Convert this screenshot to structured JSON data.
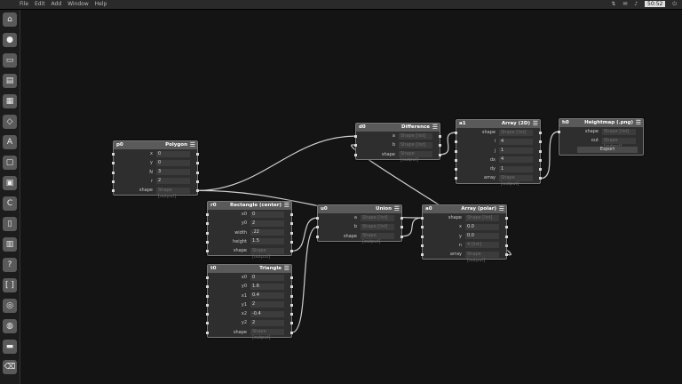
{
  "menubar": {
    "items": [
      "File",
      "Edit",
      "Add",
      "Window",
      "Help"
    ],
    "clock": "50:52"
  },
  "launcher": {
    "icons": [
      "home-icon",
      "circle-icon",
      "terminal-icon",
      "files-icon",
      "browser-icon",
      "shape-icon",
      "text-icon",
      "window-icon",
      "monitor-icon",
      "c-icon",
      "doc-icon",
      "box-icon",
      "help-icon",
      "bracket-icon",
      "disc-icon",
      "globe-icon",
      "drive-icon",
      "trash-icon"
    ]
  },
  "nodes": [
    {
      "key": "p0",
      "id": "p0",
      "title": "Polygon",
      "rows": [
        {
          "label": "x",
          "value": "0",
          "in": true,
          "out": true
        },
        {
          "label": "y",
          "value": "0",
          "in": true,
          "out": true
        },
        {
          "label": "N",
          "value": "3",
          "in": true,
          "out": true
        },
        {
          "label": "r",
          "value": "2",
          "in": true,
          "out": true
        },
        {
          "label": "shape",
          "value": "Shape [output]",
          "in": true,
          "out": true,
          "ph": true
        }
      ]
    },
    {
      "key": "d0",
      "id": "d0",
      "title": "Difference",
      "rows": [
        {
          "label": "a",
          "value": "Shape [list]",
          "in": true,
          "out": true,
          "ph": true
        },
        {
          "label": "b",
          "value": "Shape [list]",
          "in": true,
          "out": true,
          "ph": true
        },
        {
          "label": "shape",
          "value": "Shape [output]",
          "in": true,
          "out": true,
          "ph": true
        }
      ]
    },
    {
      "key": "a1",
      "id": "a1",
      "title": "Array (2D)",
      "rows": [
        {
          "label": "shape",
          "value": "Shape [list]",
          "in": true,
          "out": true,
          "ph": true
        },
        {
          "label": "i",
          "value": "4",
          "in": true,
          "out": true
        },
        {
          "label": "j",
          "value": "1",
          "in": true,
          "out": true
        },
        {
          "label": "dx",
          "value": "4",
          "in": true,
          "out": true
        },
        {
          "label": "dy",
          "value": "1",
          "in": true,
          "out": true
        },
        {
          "label": "array",
          "value": "Shape [output]",
          "in": true,
          "out": true,
          "ph": true
        }
      ]
    },
    {
      "key": "h0",
      "id": "h0",
      "title": "Heightmap (.png)",
      "rows": [
        {
          "label": "shape",
          "value": "Shape [list]",
          "in": true,
          "out": false,
          "ph": true
        },
        {
          "label": "out",
          "value": "Shape [output]",
          "in": false,
          "out": false,
          "ph": true
        }
      ],
      "button": "Export"
    },
    {
      "key": "r0",
      "id": "r0",
      "title": "Rectangle (center)",
      "rows": [
        {
          "label": "x0",
          "value": "0",
          "in": true,
          "out": true
        },
        {
          "label": "y0",
          "value": "2",
          "in": true,
          "out": true
        },
        {
          "label": "width",
          "value": ".22",
          "in": true,
          "out": true
        },
        {
          "label": "height",
          "value": "1.5",
          "in": true,
          "out": true
        },
        {
          "label": "shape",
          "value": "Shape [output]",
          "in": true,
          "out": true,
          "ph": true
        }
      ]
    },
    {
      "key": "u0",
      "id": "u0",
      "title": "Union",
      "rows": [
        {
          "label": "a",
          "value": "Shape [list]",
          "in": true,
          "out": true,
          "ph": true
        },
        {
          "label": "b",
          "value": "Shape [list]",
          "in": true,
          "out": true,
          "ph": true
        },
        {
          "label": "shape",
          "value": "Shape [output]",
          "in": true,
          "out": true,
          "ph": true
        }
      ]
    },
    {
      "key": "a0",
      "id": "a0",
      "title": "Array (polar)",
      "rows": [
        {
          "label": "shape",
          "value": "Shape [list]",
          "in": true,
          "out": true,
          "ph": true
        },
        {
          "label": "x",
          "value": "0.0",
          "in": true,
          "out": true
        },
        {
          "label": "y",
          "value": "0.0",
          "in": true,
          "out": true
        },
        {
          "label": "n",
          "value": "4 [list]",
          "in": true,
          "out": true,
          "ph": true
        },
        {
          "label": "array",
          "value": "Shape [output]",
          "in": true,
          "out": true,
          "ph": true
        }
      ]
    },
    {
      "key": "t0",
      "id": "t0",
      "title": "Triangle",
      "rows": [
        {
          "label": "x0",
          "value": "0",
          "in": true,
          "out": true
        },
        {
          "label": "y0",
          "value": "1.6",
          "in": true,
          "out": true
        },
        {
          "label": "x1",
          "value": "0.4",
          "in": true,
          "out": true
        },
        {
          "label": "y1",
          "value": "2",
          "in": true,
          "out": true
        },
        {
          "label": "x2",
          "value": "-0.4",
          "in": true,
          "out": true
        },
        {
          "label": "y2",
          "value": "2",
          "in": true,
          "out": true
        },
        {
          "label": "shape",
          "value": "Shape [output]",
          "in": true,
          "out": true,
          "ph": true
        }
      ]
    }
  ],
  "connections": [
    {
      "from": "p0.4",
      "to": "d0.0"
    },
    {
      "from": "p0.4",
      "to": "a0.0"
    },
    {
      "from": "d0.2",
      "to": "a1.0"
    },
    {
      "from": "a1.5",
      "to": "h0.0"
    },
    {
      "from": "r0.4",
      "to": "u0.0"
    },
    {
      "from": "t0.6",
      "to": "u0.1"
    },
    {
      "from": "u0.2",
      "to": "a0.0"
    },
    {
      "from": "a0.4",
      "to": "d0.1"
    }
  ]
}
